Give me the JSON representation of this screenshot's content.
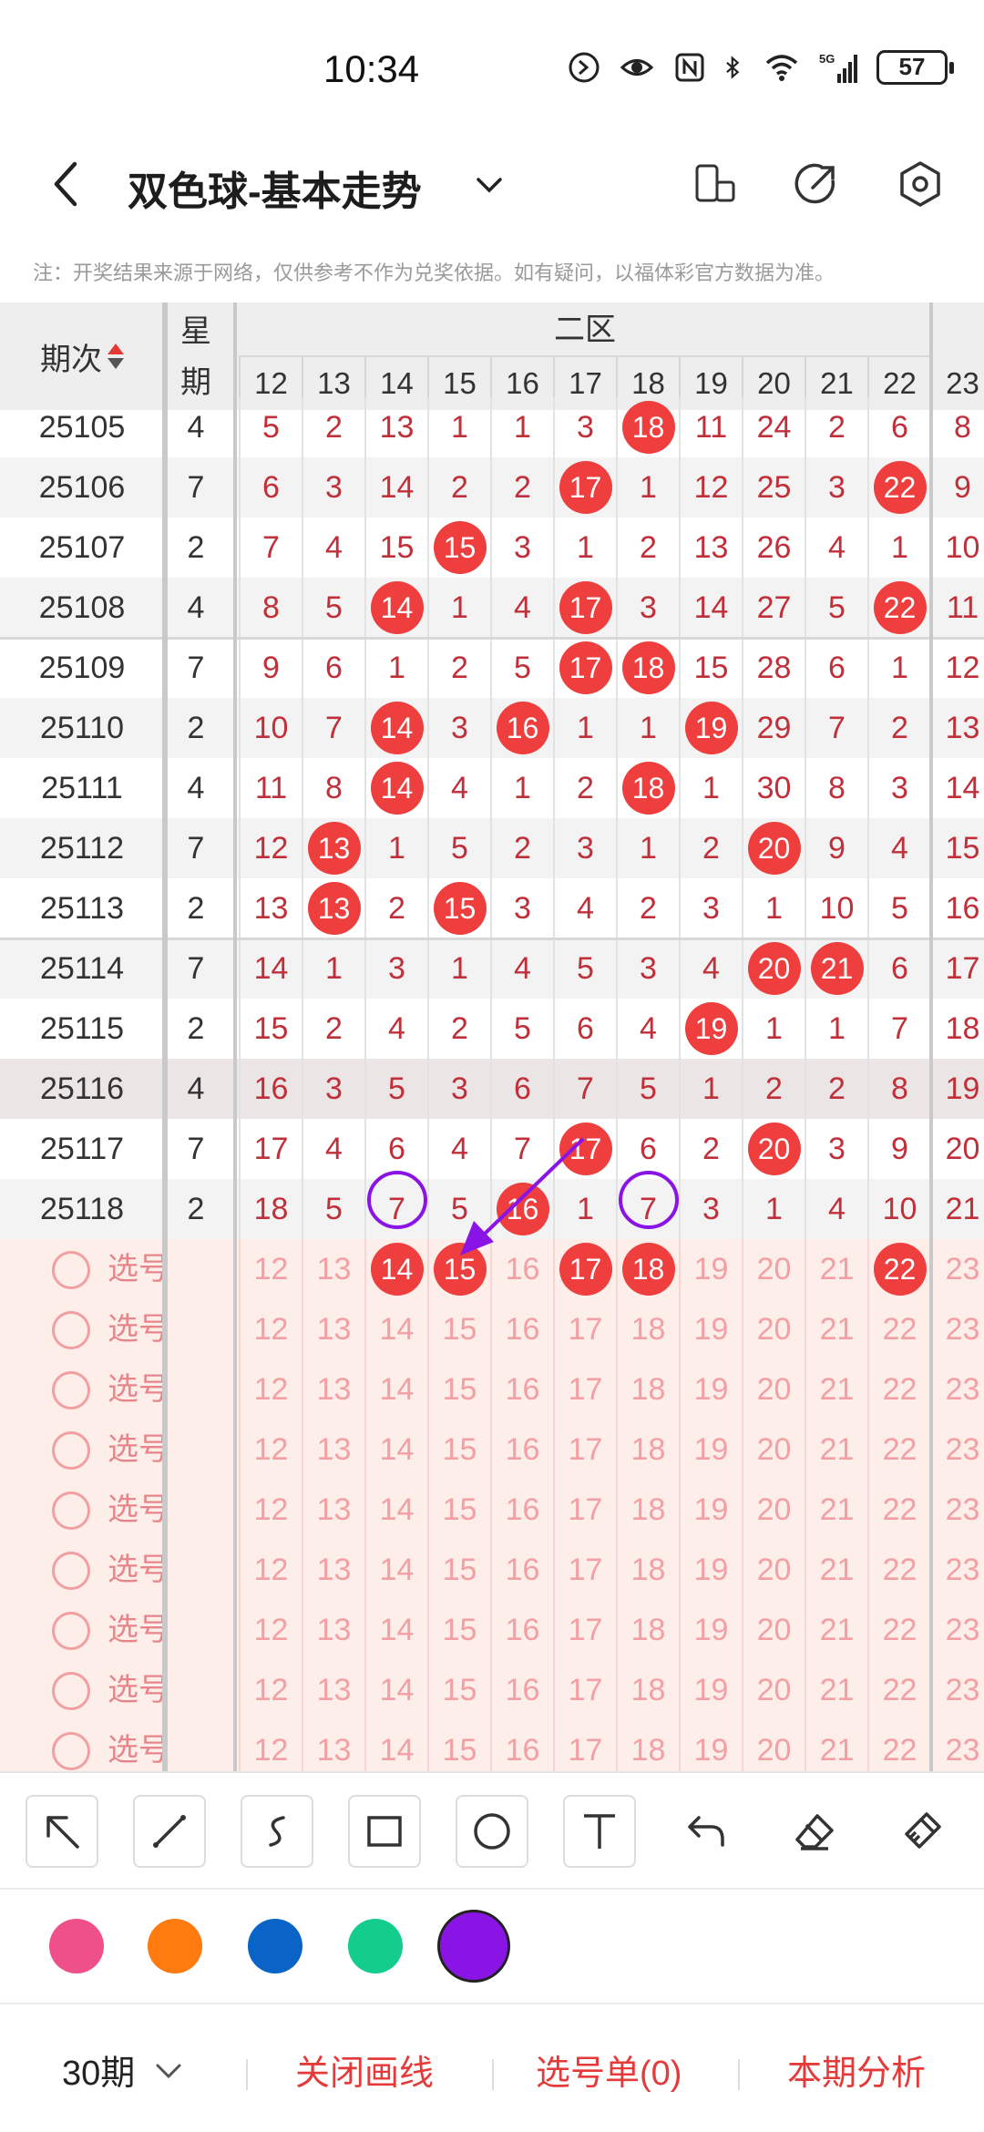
{
  "status_bar": {
    "time": "10:34",
    "battery": "57",
    "network": "5G"
  },
  "header": {
    "title": "双色球-基本走势"
  },
  "note": "注：开奖结果来源于网络，仅供参考不作为兑奖依据。如有疑问，以福体彩官方数据为准。",
  "table": {
    "col_period": "期次",
    "col_week": "星期",
    "zone_label": "二区",
    "number_headers": [
      "12",
      "13",
      "14",
      "15",
      "16",
      "17",
      "18",
      "19",
      "20",
      "21",
      "22",
      "23"
    ],
    "rows": [
      {
        "period": "25105",
        "week": "4",
        "cells": [
          [
            "5",
            0
          ],
          [
            "2",
            0
          ],
          [
            "13",
            0
          ],
          [
            "1",
            0
          ],
          [
            "1",
            0
          ],
          [
            "3",
            0
          ],
          [
            "18",
            1
          ],
          [
            "11",
            0
          ],
          [
            "24",
            0
          ],
          [
            "2",
            0
          ],
          [
            "6",
            0
          ],
          [
            "8",
            0
          ]
        ]
      },
      {
        "period": "25106",
        "week": "7",
        "cells": [
          [
            "6",
            0
          ],
          [
            "3",
            0
          ],
          [
            "14",
            0
          ],
          [
            "2",
            0
          ],
          [
            "2",
            0
          ],
          [
            "17",
            1
          ],
          [
            "1",
            0
          ],
          [
            "12",
            0
          ],
          [
            "25",
            0
          ],
          [
            "3",
            0
          ],
          [
            "22",
            1
          ],
          [
            "9",
            0
          ]
        ]
      },
      {
        "period": "25107",
        "week": "2",
        "cells": [
          [
            "7",
            0
          ],
          [
            "4",
            0
          ],
          [
            "15",
            0
          ],
          [
            "15",
            1
          ],
          [
            "3",
            0
          ],
          [
            "1",
            0
          ],
          [
            "2",
            0
          ],
          [
            "13",
            0
          ],
          [
            "26",
            0
          ],
          [
            "4",
            0
          ],
          [
            "1",
            0
          ],
          [
            "10",
            0
          ]
        ]
      },
      {
        "period": "25108",
        "week": "4",
        "cells": [
          [
            "8",
            0
          ],
          [
            "5",
            0
          ],
          [
            "14",
            1
          ],
          [
            "1",
            0
          ],
          [
            "4",
            0
          ],
          [
            "17",
            1
          ],
          [
            "3",
            0
          ],
          [
            "14",
            0
          ],
          [
            "27",
            0
          ],
          [
            "5",
            0
          ],
          [
            "22",
            1
          ],
          [
            "11",
            0
          ]
        ]
      },
      {
        "period": "25109",
        "week": "7",
        "cells": [
          [
            "9",
            0
          ],
          [
            "6",
            0
          ],
          [
            "1",
            0
          ],
          [
            "2",
            0
          ],
          [
            "5",
            0
          ],
          [
            "17",
            1
          ],
          [
            "18",
            1
          ],
          [
            "15",
            0
          ],
          [
            "28",
            0
          ],
          [
            "6",
            0
          ],
          [
            "1",
            0
          ],
          [
            "12",
            0
          ]
        ]
      },
      {
        "period": "25110",
        "week": "2",
        "cells": [
          [
            "10",
            0
          ],
          [
            "7",
            0
          ],
          [
            "14",
            1
          ],
          [
            "3",
            0
          ],
          [
            "16",
            1
          ],
          [
            "1",
            0
          ],
          [
            "1",
            0
          ],
          [
            "19",
            1
          ],
          [
            "29",
            0
          ],
          [
            "7",
            0
          ],
          [
            "2",
            0
          ],
          [
            "13",
            0
          ]
        ]
      },
      {
        "period": "25111",
        "week": "4",
        "cells": [
          [
            "11",
            0
          ],
          [
            "8",
            0
          ],
          [
            "14",
            1
          ],
          [
            "4",
            0
          ],
          [
            "1",
            0
          ],
          [
            "2",
            0
          ],
          [
            "18",
            1
          ],
          [
            "1",
            0
          ],
          [
            "30",
            0
          ],
          [
            "8",
            0
          ],
          [
            "3",
            0
          ],
          [
            "14",
            0
          ]
        ]
      },
      {
        "period": "25112",
        "week": "7",
        "cells": [
          [
            "12",
            0
          ],
          [
            "13",
            1
          ],
          [
            "1",
            0
          ],
          [
            "5",
            0
          ],
          [
            "2",
            0
          ],
          [
            "3",
            0
          ],
          [
            "1",
            0
          ],
          [
            "2",
            0
          ],
          [
            "20",
            1
          ],
          [
            "9",
            0
          ],
          [
            "4",
            0
          ],
          [
            "15",
            0
          ]
        ]
      },
      {
        "period": "25113",
        "week": "2",
        "cells": [
          [
            "13",
            0
          ],
          [
            "13",
            1
          ],
          [
            "2",
            0
          ],
          [
            "15",
            1
          ],
          [
            "3",
            0
          ],
          [
            "4",
            0
          ],
          [
            "2",
            0
          ],
          [
            "3",
            0
          ],
          [
            "1",
            0
          ],
          [
            "10",
            0
          ],
          [
            "5",
            0
          ],
          [
            "16",
            0
          ]
        ]
      },
      {
        "period": "25114",
        "week": "7",
        "cells": [
          [
            "14",
            0
          ],
          [
            "1",
            0
          ],
          [
            "3",
            0
          ],
          [
            "1",
            0
          ],
          [
            "4",
            0
          ],
          [
            "5",
            0
          ],
          [
            "3",
            0
          ],
          [
            "4",
            0
          ],
          [
            "20",
            1
          ],
          [
            "21",
            1
          ],
          [
            "6",
            0
          ],
          [
            "17",
            0
          ]
        ]
      },
      {
        "period": "25115",
        "week": "2",
        "cells": [
          [
            "15",
            0
          ],
          [
            "2",
            0
          ],
          [
            "4",
            0
          ],
          [
            "2",
            0
          ],
          [
            "5",
            0
          ],
          [
            "6",
            0
          ],
          [
            "4",
            0
          ],
          [
            "19",
            1
          ],
          [
            "1",
            0
          ],
          [
            "1",
            0
          ],
          [
            "7",
            0
          ],
          [
            "18",
            0
          ]
        ]
      },
      {
        "period": "25116",
        "week": "4",
        "cells": [
          [
            "16",
            0
          ],
          [
            "3",
            0
          ],
          [
            "5",
            0
          ],
          [
            "3",
            0
          ],
          [
            "6",
            0
          ],
          [
            "7",
            0
          ],
          [
            "5",
            0
          ],
          [
            "1",
            0
          ],
          [
            "2",
            0
          ],
          [
            "2",
            0
          ],
          [
            "8",
            0
          ],
          [
            "19",
            0
          ]
        ]
      },
      {
        "period": "25117",
        "week": "7",
        "cells": [
          [
            "17",
            0
          ],
          [
            "4",
            0
          ],
          [
            "6",
            0
          ],
          [
            "4",
            0
          ],
          [
            "7",
            0
          ],
          [
            "17",
            1
          ],
          [
            "6",
            0
          ],
          [
            "2",
            0
          ],
          [
            "20",
            1
          ],
          [
            "3",
            0
          ],
          [
            "9",
            0
          ],
          [
            "20",
            0
          ]
        ]
      },
      {
        "period": "25118",
        "week": "2",
        "cells": [
          [
            "18",
            0
          ],
          [
            "5",
            0
          ],
          [
            "7",
            0
          ],
          [
            "5",
            0
          ],
          [
            "16",
            1
          ],
          [
            "1",
            0
          ],
          [
            "7",
            0
          ],
          [
            "3",
            0
          ],
          [
            "1",
            0
          ],
          [
            "4",
            0
          ],
          [
            "10",
            0
          ],
          [
            "21",
            0
          ]
        ]
      }
    ],
    "pick_label": "选号",
    "pick_first_selected": [
      "14",
      "15",
      "17",
      "18",
      "22"
    ]
  },
  "toolbar": {
    "tools": [
      "arrow-tool",
      "line-tool",
      "curve-tool",
      "rect-tool",
      "circle-tool",
      "text-tool",
      "undo-tool",
      "eraser-tool",
      "clear-tool"
    ]
  },
  "colors": [
    "#f0508a",
    "#ff7a0f",
    "#0a64c8",
    "#14cc8c",
    "#8a14e6"
  ],
  "selected_color": "#8a14e6",
  "bottom_bar": {
    "period": "30期",
    "close_lines": "关闭画线",
    "pick_list": "选号单(0)",
    "analysis": "本期分析"
  }
}
